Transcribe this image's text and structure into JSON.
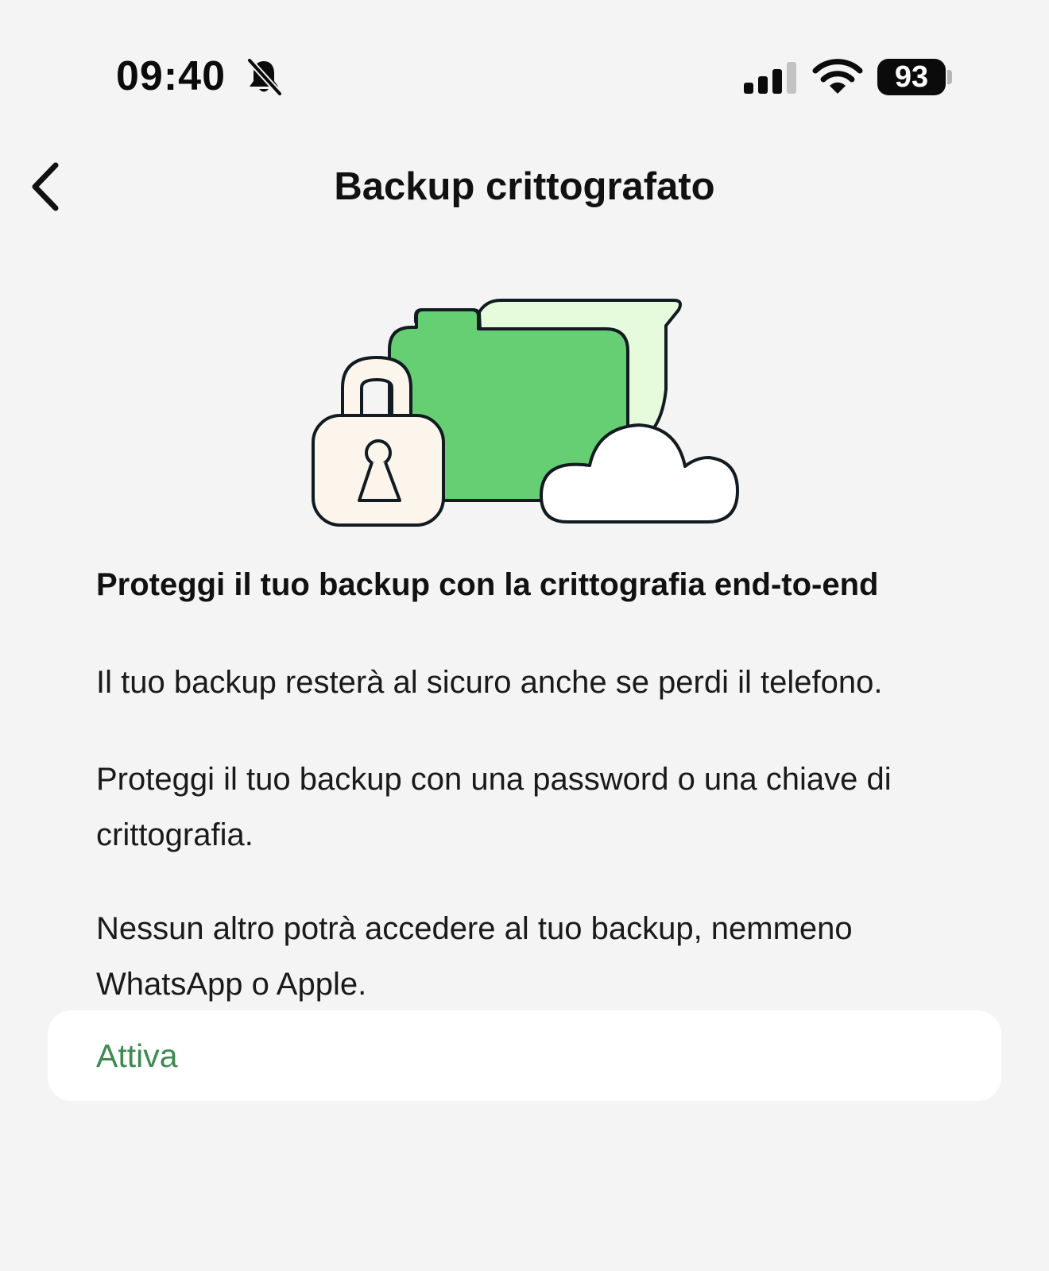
{
  "status_bar": {
    "time": "09:40",
    "bell_icon": "bell-slash-icon",
    "signal_icon": "cellular-signal-icon",
    "wifi_icon": "wifi-icon",
    "battery_level": "93"
  },
  "nav": {
    "back_icon": "chevron-left-icon",
    "title": "Backup crittografato"
  },
  "illustration": {
    "icon": "lock-folder-cloud-illustration",
    "colors": {
      "folder": "#66cf74",
      "folder_back": "#e6fbdc",
      "lock": "#fbf5ec",
      "cloud": "#ffffff",
      "outline": "#111b21"
    }
  },
  "content": {
    "heading": "Proteggi il tuo backup con la crittografia end-to-end",
    "paragraphs": [
      "Il tuo backup resterà al sicuro anche se perdi il telefono.",
      "Proteggi il tuo backup con una password o una chiave di crittografia.",
      "Nessun altro potrà accedere al tuo backup, nemmeno WhatsApp o Apple."
    ]
  },
  "action": {
    "label": "Attiva",
    "color": "#3d8a52"
  }
}
